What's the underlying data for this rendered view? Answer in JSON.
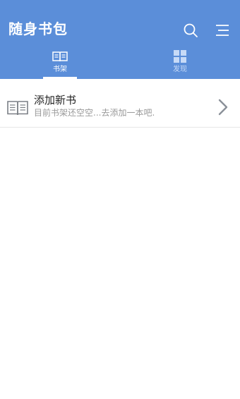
{
  "app": {
    "title": "随身书包"
  },
  "header": {
    "search_icon": "search-icon",
    "menu_icon": "menu-icon",
    "accent": "#5b8ed9"
  },
  "tabs": [
    {
      "label": "书架",
      "icon": "book-open-icon",
      "active": true
    },
    {
      "label": "发现",
      "icon": "grid-icon",
      "active": false
    }
  ],
  "bookshelf": {
    "add_book": {
      "title": "添加新书",
      "subtitle": "目前书架还空空...去添加一本吧.",
      "icon": "book-open-icon",
      "arrow_icon": "chevron-right-icon"
    }
  }
}
